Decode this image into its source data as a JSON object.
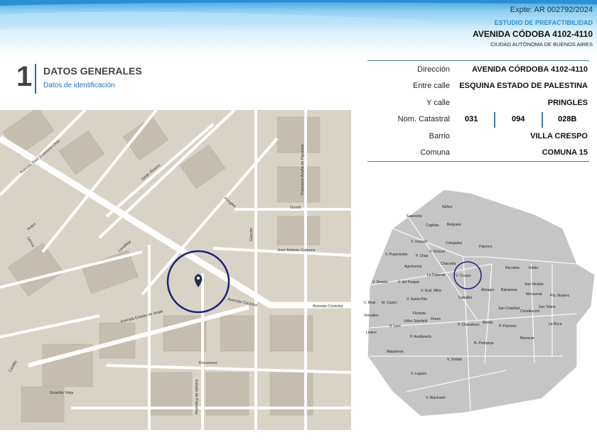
{
  "header": {
    "expediente": "Expte: AR 002792/2024",
    "study": "ESTUDIO DE PREFACTIBILIDAD",
    "address": "AVENIDA CÓDOBA 4102-4110",
    "city": "CIUDAD AUTÓNOMA DE BUENOS AIRES"
  },
  "section": {
    "number": "1",
    "title": "DATOS GENERALES",
    "subtitle": "Datos de identificación"
  },
  "info": {
    "direccion": {
      "label": "Dirección",
      "value": "AVENIDA CÓRDOBA 4102-4110"
    },
    "entre": {
      "label": "Entre calle",
      "value": "ESQUINA ESTADO DE PALESTINA"
    },
    "ycalle": {
      "label": "Y calle",
      "value": "PRINGLES"
    },
    "catastral": {
      "label": "Nom. Catastral",
      "seccion": "031",
      "manzana": "094",
      "parcela": "028B"
    },
    "barrio": {
      "label": "Barrio",
      "value": "VILLA CRESPO"
    },
    "comuna": {
      "label": "Comuna",
      "value": "COMUNA 15"
    }
  },
  "street_map": {
    "streets": [
      "Avenida Córdoba",
      "Avenida Estado de Israel",
      "Avenida Córdoba",
      "José Antonio Cabrera",
      "Gorriti",
      "Pringles",
      "Rocamora",
      "Guardia Vieja",
      "Lavalleja",
      "Julián Álvarez",
      "Aráoz",
      "Gascón",
      "Francisco Acuña de Figueroa",
      "Lerma",
      "Estado de Palestina",
      "Avenida Raúl Scalabrini Ortiz",
      "Castillo"
    ],
    "marker": "location-pin"
  },
  "barrios_map": {
    "highlight": "V. Crespo",
    "labels": [
      "Núñez",
      "Saavedra",
      "Coghlan",
      "Belgrano",
      "V. Urquiza",
      "Colegiales",
      "Palermo",
      "V. Pueyrredón",
      "P. Chas",
      "V. Ortúzar",
      "Chacarita",
      "Agronomía",
      "La Paternal",
      "V. Crespo",
      "Recoleta",
      "Retiro",
      "V. Devoto",
      "V. del Parque",
      "Almagro",
      "Balvanera",
      "San Nicolás",
      "V. Gral. Mitre",
      "Caballito",
      "Monserrat",
      "Pto. Madero",
      "V. Real",
      "M. Castro",
      "V. Santa Rita",
      "San Cristóbal",
      "San Telmo",
      "Versalles",
      "Floresta",
      "Flores",
      "Boedo",
      "Constitución",
      "Vélez Sársfield",
      "V. Luro",
      "P. Chacabuco",
      "P. Patricios",
      "La Boca",
      "Liniers",
      "P. Avellaneda",
      "N. Pompeya",
      "Barracas",
      "Mataderos",
      "V. Soldati",
      "V. Lugano",
      "V. Riachuelo"
    ]
  }
}
